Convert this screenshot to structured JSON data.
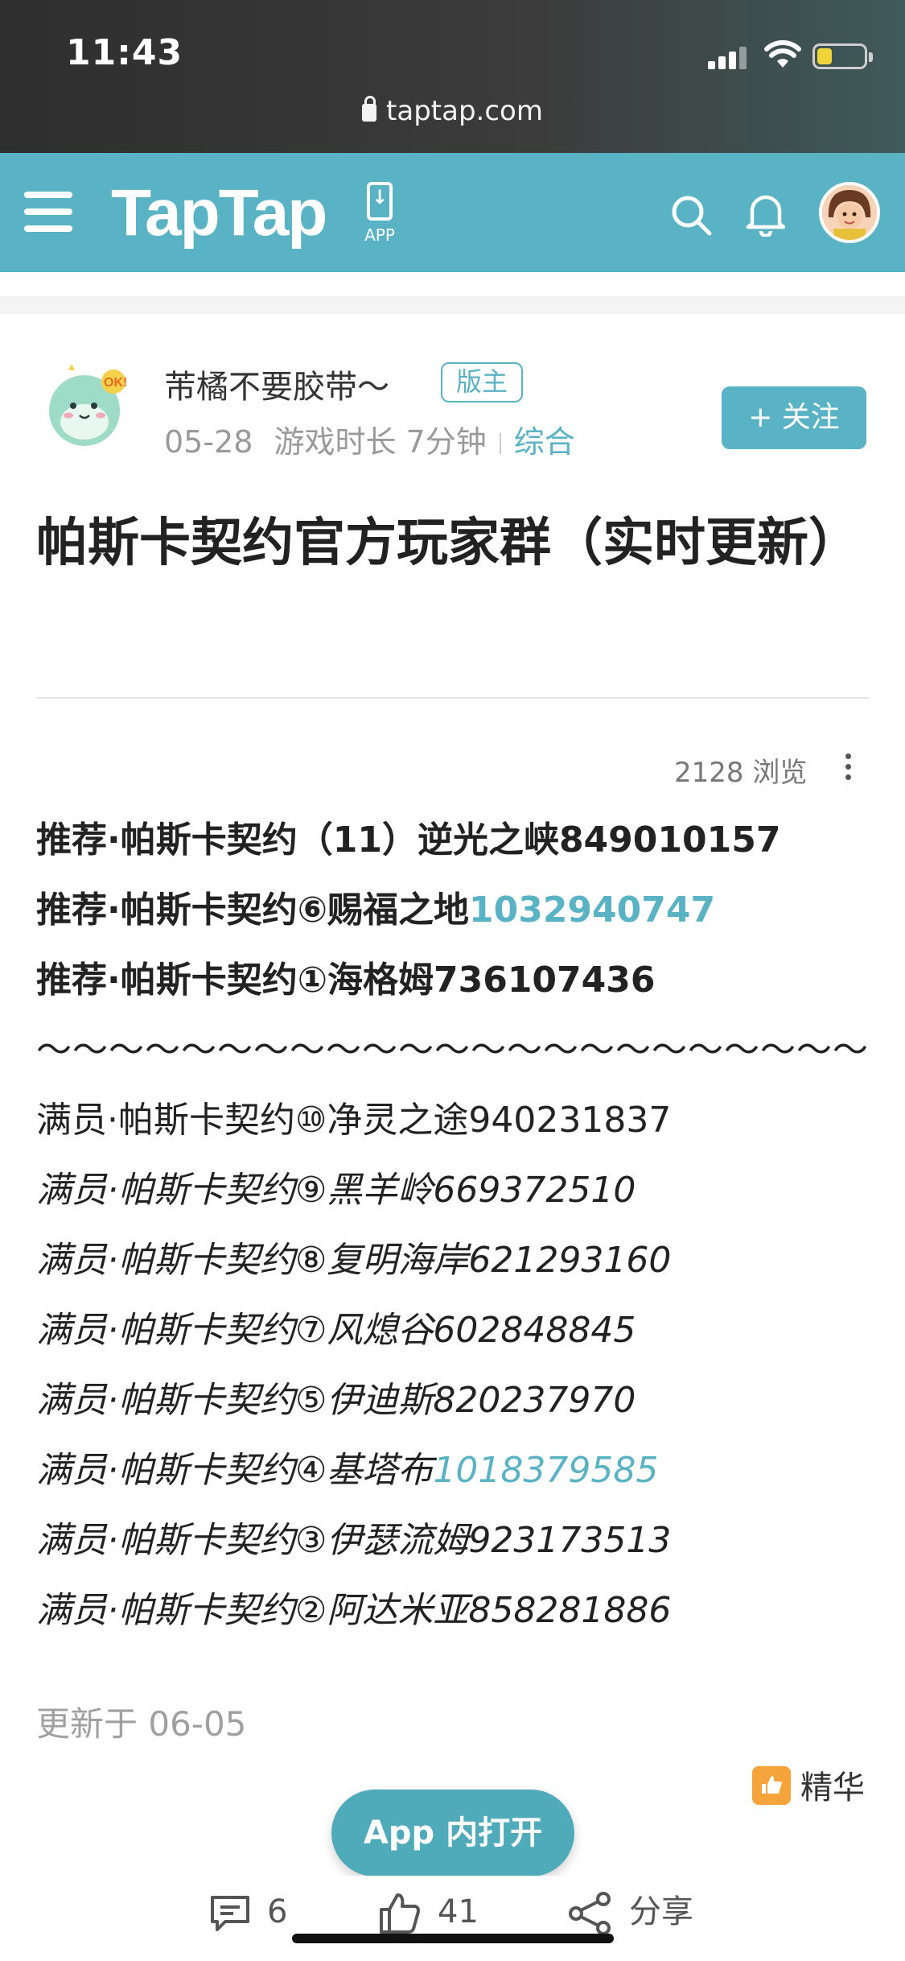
{
  "status_bar": {
    "time": "11:43",
    "url": "taptap.com"
  },
  "navbar": {
    "logo": "TapTap",
    "app_label": "APP"
  },
  "post": {
    "author": {
      "name": "芾橘不要胶带～",
      "badge": "版主"
    },
    "meta": {
      "date": "05-28",
      "play_time": "游戏时长 7分钟",
      "category": "综合"
    },
    "follow_label": "+ 关注",
    "title": "帕斯卡契约官方玩家群（实时更新）",
    "views": "2128 浏览",
    "lines": [
      {
        "prefix": "推荐·帕斯卡契约（11）逆光之峡849010157",
        "link": "",
        "style": "bold"
      },
      {
        "prefix": "推荐·帕斯卡契约⑥赐福之地",
        "link": "1032940747",
        "style": "bold"
      },
      {
        "prefix": "推荐·帕斯卡契约①海格姆736107436",
        "link": "",
        "style": "bold"
      },
      {
        "prefix": "～～～～～～～～～～～～～～～～～～～～～～～",
        "link": "",
        "style": "tilde"
      },
      {
        "prefix": "满员·帕斯卡契约⑩净灵之途940231837",
        "link": "",
        "style": "normal"
      },
      {
        "prefix": "满员·帕斯卡契约⑨黑羊岭669372510",
        "link": "",
        "style": "italic"
      },
      {
        "prefix": "满员·帕斯卡契约⑧复明海岸621293160",
        "link": "",
        "style": "italic"
      },
      {
        "prefix": "满员·帕斯卡契约⑦风熄谷602848845",
        "link": "",
        "style": "italic"
      },
      {
        "prefix": "满员·帕斯卡契约⑤伊迪斯820237970",
        "link": "",
        "style": "italic"
      },
      {
        "prefix": "满员·帕斯卡契约④基塔布",
        "link": "1018379585",
        "style": "italic"
      },
      {
        "prefix": "满员·帕斯卡契约③伊瑟流姆923173513",
        "link": "",
        "style": "italic"
      },
      {
        "prefix": "满员·帕斯卡契约②阿达米亚858281886",
        "link": "",
        "style": "italic"
      }
    ],
    "updated": "更新于 06-05",
    "essence_label": "精华"
  },
  "open_app_label": "App 内打开",
  "bottom_bar": {
    "comments": "6",
    "likes": "41",
    "share_label": "分享"
  },
  "colors": {
    "accent": "#5ab3c4",
    "open_app": "#4faab9",
    "essence": "#f4a43a"
  }
}
